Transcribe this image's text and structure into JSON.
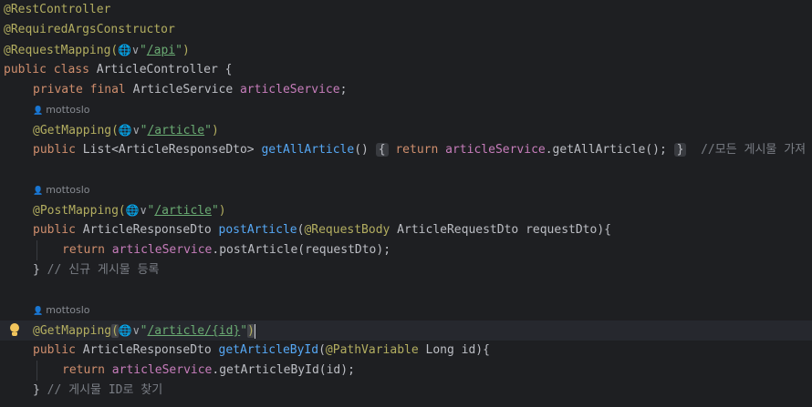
{
  "editor": {
    "lines": {
      "l1": "@RestController",
      "l2": "@RequiredArgsConstructor",
      "l3_ann": "@RequestMapping(",
      "l3_globe": "🌐∨",
      "l3_q1": "\"",
      "l3_path": "/api",
      "l3_q2": "\"",
      "l3_end": ")",
      "l4_kw": "public class ",
      "l4_name": "ArticleController {",
      "l5_kw": "private final ",
      "l5_type": "ArticleService ",
      "l5_field": "articleService",
      "l5_end": ";",
      "author1": "mottoslo",
      "l7_ann": "@GetMapping(",
      "l7_globe": "🌐∨",
      "l7_q1": "\"",
      "l7_path": "/article",
      "l7_q2": "\"",
      "l7_end": ")",
      "l8_kw": "public ",
      "l8_type": "List<ArticleResponseDto> ",
      "l8_fn": "getAllArticle",
      "l8_paren": "()",
      "l8_fold_open": "{",
      "l8_ret": "return ",
      "l8_field": "articleService",
      "l8_call": ".getAllArticle();",
      "l8_fold_close": "}",
      "l8_cmt": "  //모든 게시물 가져",
      "author2": "mottoslo",
      "l11_ann": "@PostMapping(",
      "l11_globe": "🌐∨",
      "l11_q1": "\"",
      "l11_path": "/article",
      "l11_q2": "\"",
      "l11_end": ")",
      "l12_kw": "public ",
      "l12_type": "ArticleResponseDto ",
      "l12_fn": "postArticle",
      "l12_p1": "(",
      "l12_ann": "@RequestBody",
      "l12_rest": " ArticleRequestDto requestDto){",
      "l13_kw": "return ",
      "l13_field": "articleService",
      "l13_call": ".postArticle(requestDto);",
      "l14_brace": "} ",
      "l14_cmt": "// 신규 게시물 등록",
      "author3": "mottoslo",
      "l17_ann": "@GetMapping",
      "l17_p": "(",
      "l17_globe": "🌐∨",
      "l17_q1": "\"",
      "l17_path": "/article/",
      "l17_var": "{id}",
      "l17_q2": "\"",
      "l17_end": ")",
      "l18_kw": "public ",
      "l18_type": "ArticleResponseDto ",
      "l18_fn": "getArticleById",
      "l18_p1": "(",
      "l18_ann": "@PathVariable",
      "l18_rest": " Long id){",
      "l19_kw": "return ",
      "l19_field": "articleService",
      "l19_call": ".getArticleById(id);",
      "l20_brace": "} ",
      "l20_cmt": "// 게시물 ID로 찾기"
    },
    "icons": {
      "author": "person-icon",
      "globe": "globe-icon",
      "intention": "lightbulb-icon"
    },
    "colors": {
      "background": "#1e1f22",
      "annotation": "#b3ae60",
      "keyword": "#cf8e6d",
      "field": "#c77dbb",
      "function": "#56a8f5",
      "string": "#6aab73",
      "comment": "#7a7e85",
      "bulb": "#f2c55c"
    }
  }
}
